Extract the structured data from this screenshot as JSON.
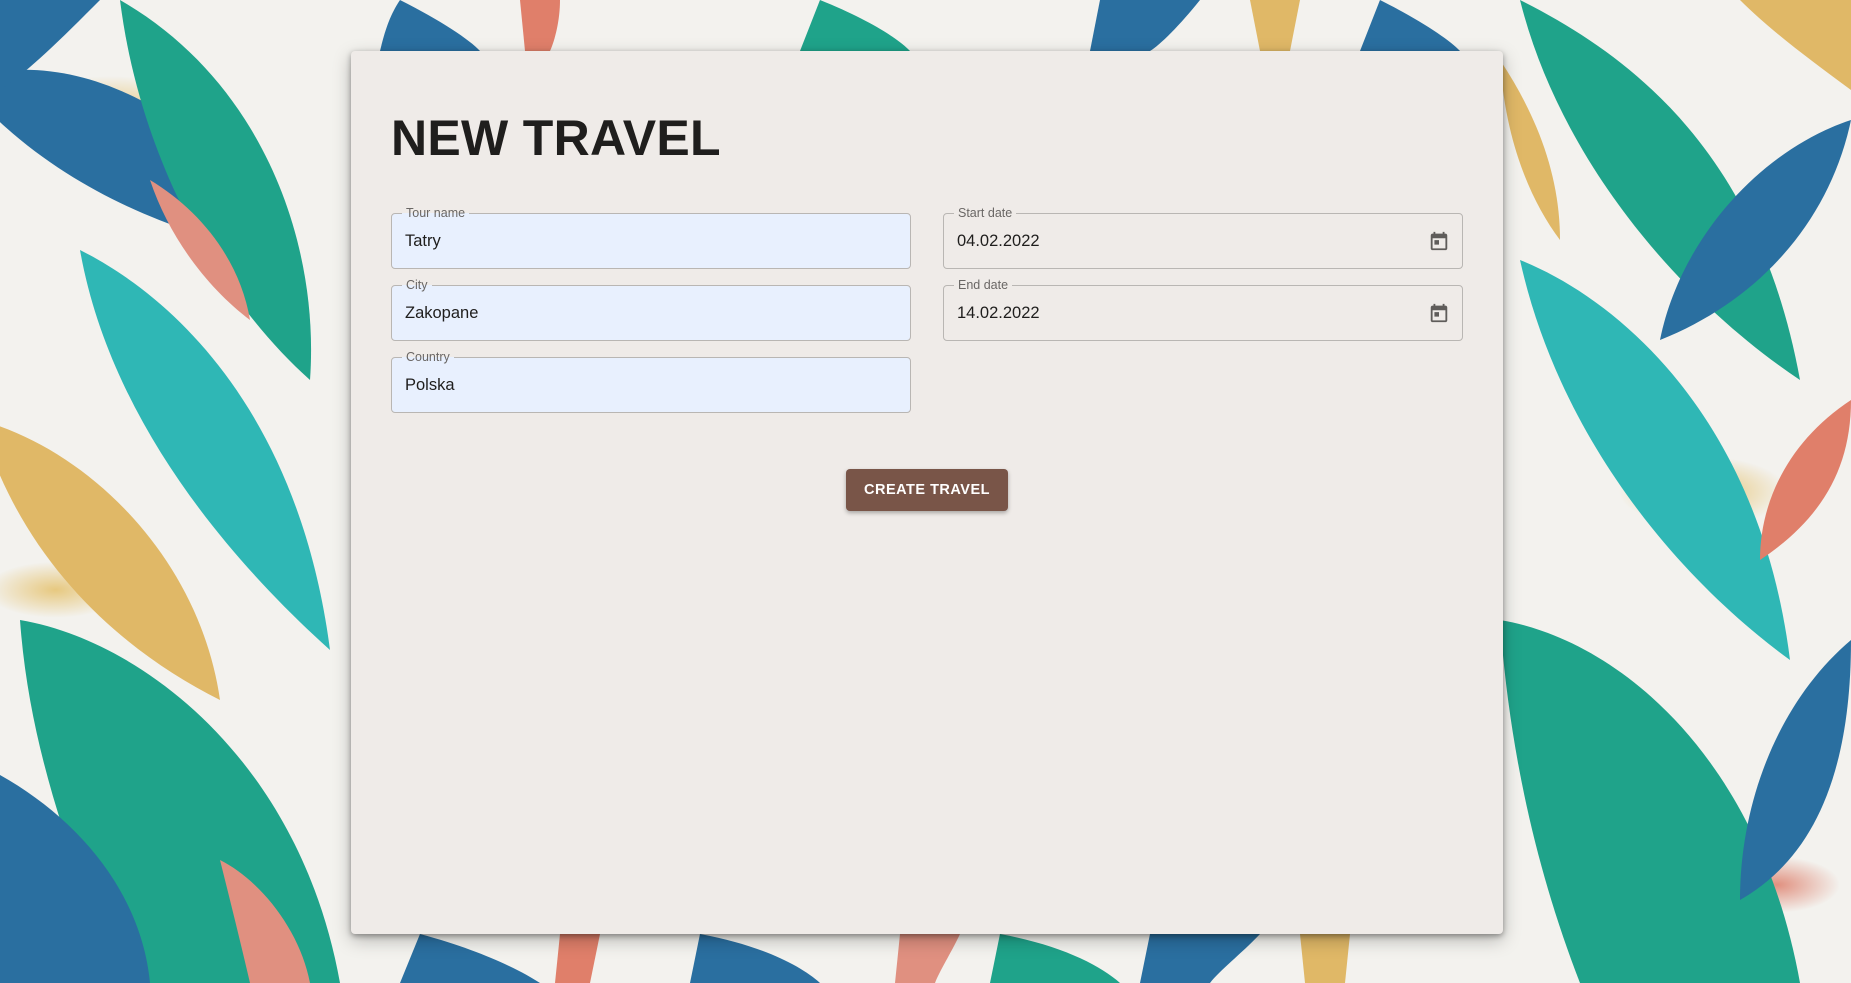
{
  "page": {
    "title": "NEW TRAVEL"
  },
  "form": {
    "tour_name": {
      "label": "Tour name",
      "value": "Tatry"
    },
    "city": {
      "label": "City",
      "value": "Zakopane"
    },
    "country": {
      "label": "Country",
      "value": "Polska"
    },
    "start_date": {
      "label": "Start date",
      "value": "04.02.2022",
      "icon": "calendar-icon"
    },
    "end_date": {
      "label": "End date",
      "value": "14.02.2022",
      "icon": "calendar-icon"
    },
    "submit_label": "CREATE TRAVEL"
  },
  "colors": {
    "card_bg": "#efebe8",
    "autofill_bg": "#e8f0fe",
    "button_bg": "#795548",
    "title_text": "#1f1e1d"
  }
}
